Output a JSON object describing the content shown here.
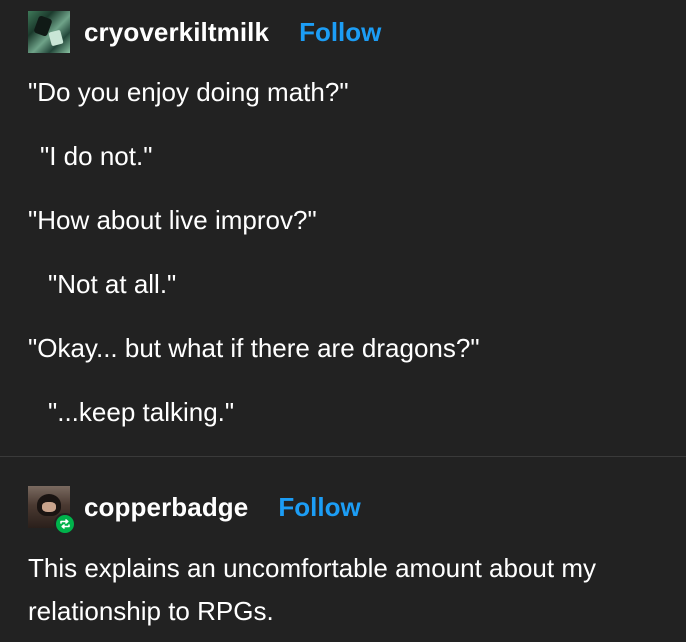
{
  "post1": {
    "username": "cryoverkiltmilk",
    "follow_label": "Follow",
    "avatar_icon": "user-avatar-icon",
    "lines": [
      "\"Do you enjoy doing math?\"",
      "\"I do not.\"",
      "\"How about live improv?\"",
      "\"Not at all.\"",
      "\"Okay... but what if there are dragons?\"",
      "\"...keep talking.\""
    ]
  },
  "post2": {
    "username": "copperbadge",
    "follow_label": "Follow",
    "avatar_icon": "user-avatar-icon",
    "badge_icon": "reblog-icon",
    "body": "This explains an uncomfortable amount about my relationship to RPGs."
  },
  "colors": {
    "background": "#222222",
    "text": "#ffffff",
    "follow": "#1c9df5",
    "reblog_badge": "#00b34b",
    "divider": "#3a3a3a"
  }
}
